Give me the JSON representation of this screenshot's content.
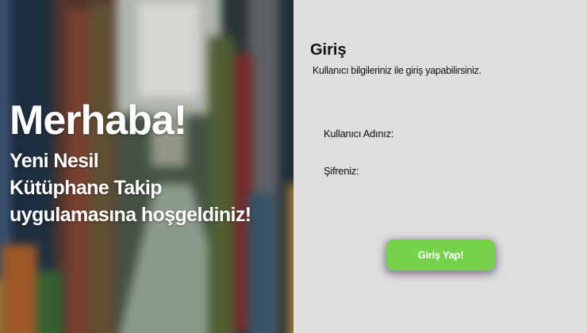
{
  "hero": {
    "title": "Merhaba!",
    "subtitle_lines": [
      "Yeni Nesil",
      "Kütüphane Takip",
      "uygulamasına hoşgeldiniz!"
    ]
  },
  "login": {
    "title": "Giriş",
    "subtitle": "Kullanıcı bilgileriniz ile giriş yapabilirsiniz.",
    "username_label": "Kullanıcı Adınız:",
    "username_value": "",
    "password_label": "Şifreniz:",
    "password_value": "",
    "submit_label": "Giriş Yap!"
  },
  "colors": {
    "panel_background": "#dedede",
    "button": "#76d14b",
    "button_text": "#ffffff"
  }
}
